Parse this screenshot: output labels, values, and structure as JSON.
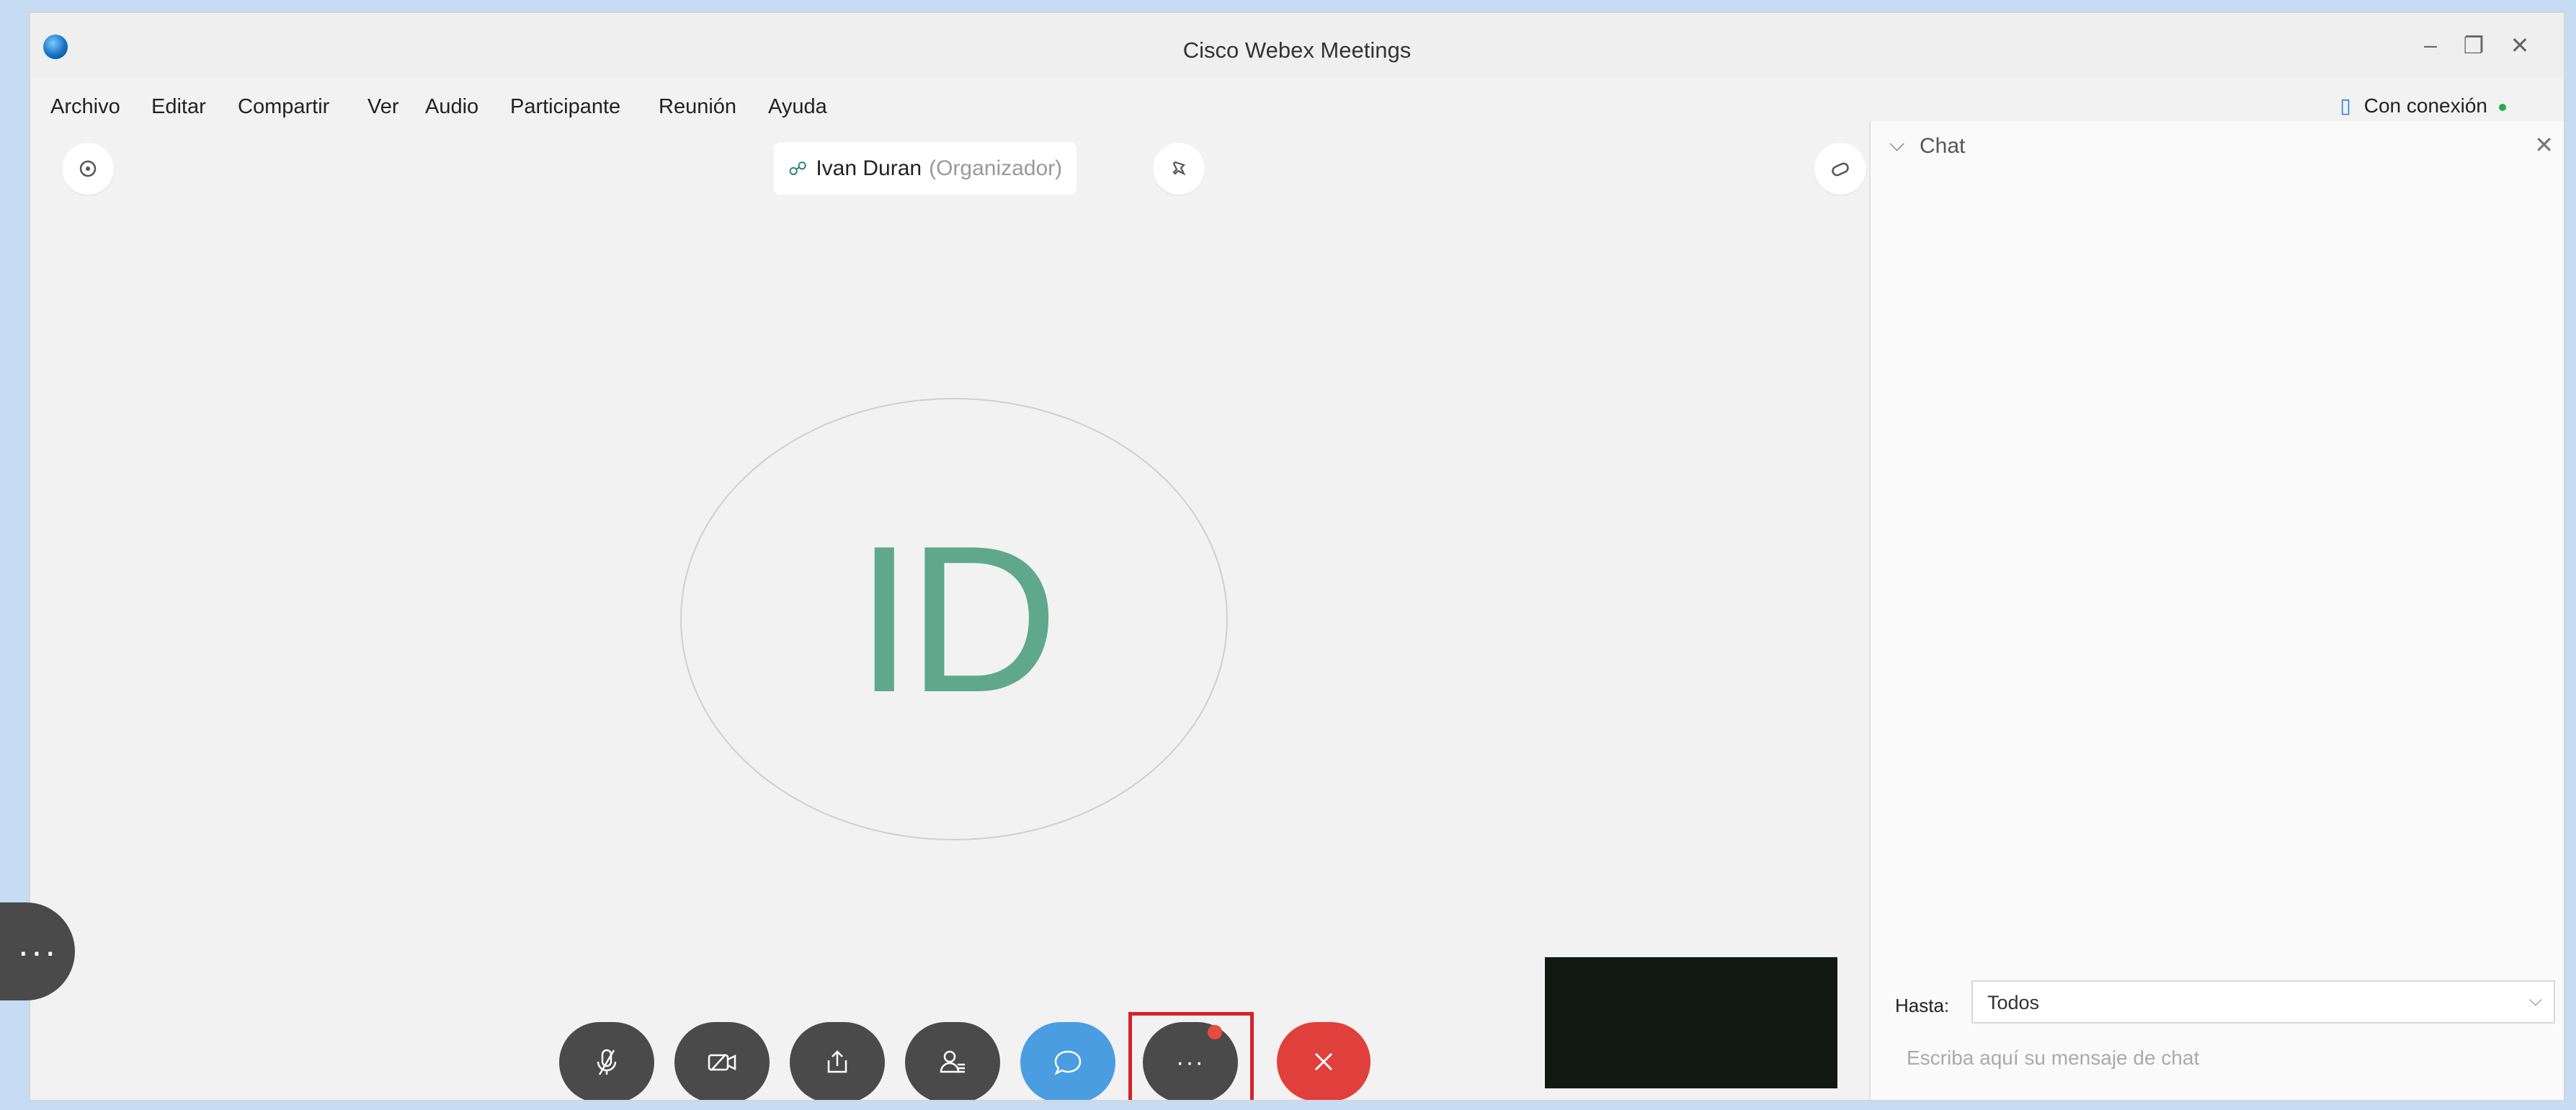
{
  "window": {
    "title": "Cisco Webex Meetings",
    "minimize": "–",
    "restore": "❐",
    "close": "✕"
  },
  "menu": [
    {
      "label": "Archivo"
    },
    {
      "label": "Editar"
    },
    {
      "label": "Compartir"
    },
    {
      "label": "Ver"
    },
    {
      "label": "Audio"
    },
    {
      "label": "Participante"
    },
    {
      "label": "Reunión"
    },
    {
      "label": "Ayuda"
    }
  ],
  "connection": {
    "label": "Con conexión",
    "status_color": "#2aa84a"
  },
  "stage": {
    "presenter_name": "Ivan Duran",
    "presenter_role": "(Organizador)",
    "avatar_initials": "ID",
    "avatar_color": "#5fa88e",
    "more_label": "···"
  },
  "controls": [
    {
      "name": "mute-button",
      "icon": "mic-off-icon"
    },
    {
      "name": "video-button",
      "icon": "video-off-icon"
    },
    {
      "name": "share-button",
      "icon": "share-icon"
    },
    {
      "name": "participants-button",
      "icon": "participants-icon"
    },
    {
      "name": "chat-button",
      "icon": "chat-icon"
    },
    {
      "name": "more-options-button",
      "icon": "more-icon",
      "label": "···"
    },
    {
      "name": "leave-button",
      "icon": "close-icon"
    }
  ],
  "chat": {
    "title": "Chat",
    "to_label": "Hasta:",
    "to_value": "Todos",
    "input_placeholder": "Escriba aquí su mensaje de chat"
  },
  "colors": {
    "accent_blue": "#4a9de0",
    "leave_red": "#e0403c",
    "highlight_red": "#d3242b",
    "control_dark": "#4a4a4a"
  }
}
